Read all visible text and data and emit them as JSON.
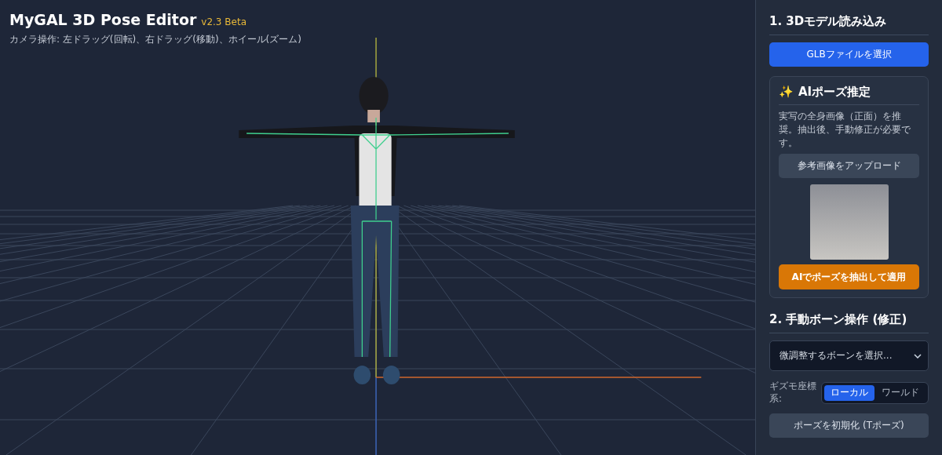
{
  "header": {
    "title": "MyGAL 3D Pose Editor",
    "version": "v2.3 Beta",
    "hint": "カメラ操作: 左ドラッグ(回転)、右ドラッグ(移動)、ホイール(ズーム)"
  },
  "sidebar": {
    "section_1": {
      "title": "1. 3Dモデル読み込み",
      "button": "GLBファイルを選択"
    },
    "ai_card": {
      "icon": "✨",
      "title": "AIポーズ推定",
      "description": "実写の全身画像（正面）を推奨。抽出後、手動修正が必要です。",
      "upload_button": "参考画像をアップロード",
      "apply_button": "AIでポーズを抽出して適用"
    },
    "section_2": {
      "title": "2. 手動ボーン操作 (修正)",
      "bone_select": {
        "placeholder": "微調整するボーンを選択..."
      },
      "gizmo_label": "ギズモ座標系:",
      "gizmo_options": [
        {
          "label": "ローカル",
          "selected": true
        },
        {
          "label": "ワールド",
          "selected": false
        }
      ],
      "reset_button": "ポーズを初期化 (Tポーズ)"
    }
  }
}
